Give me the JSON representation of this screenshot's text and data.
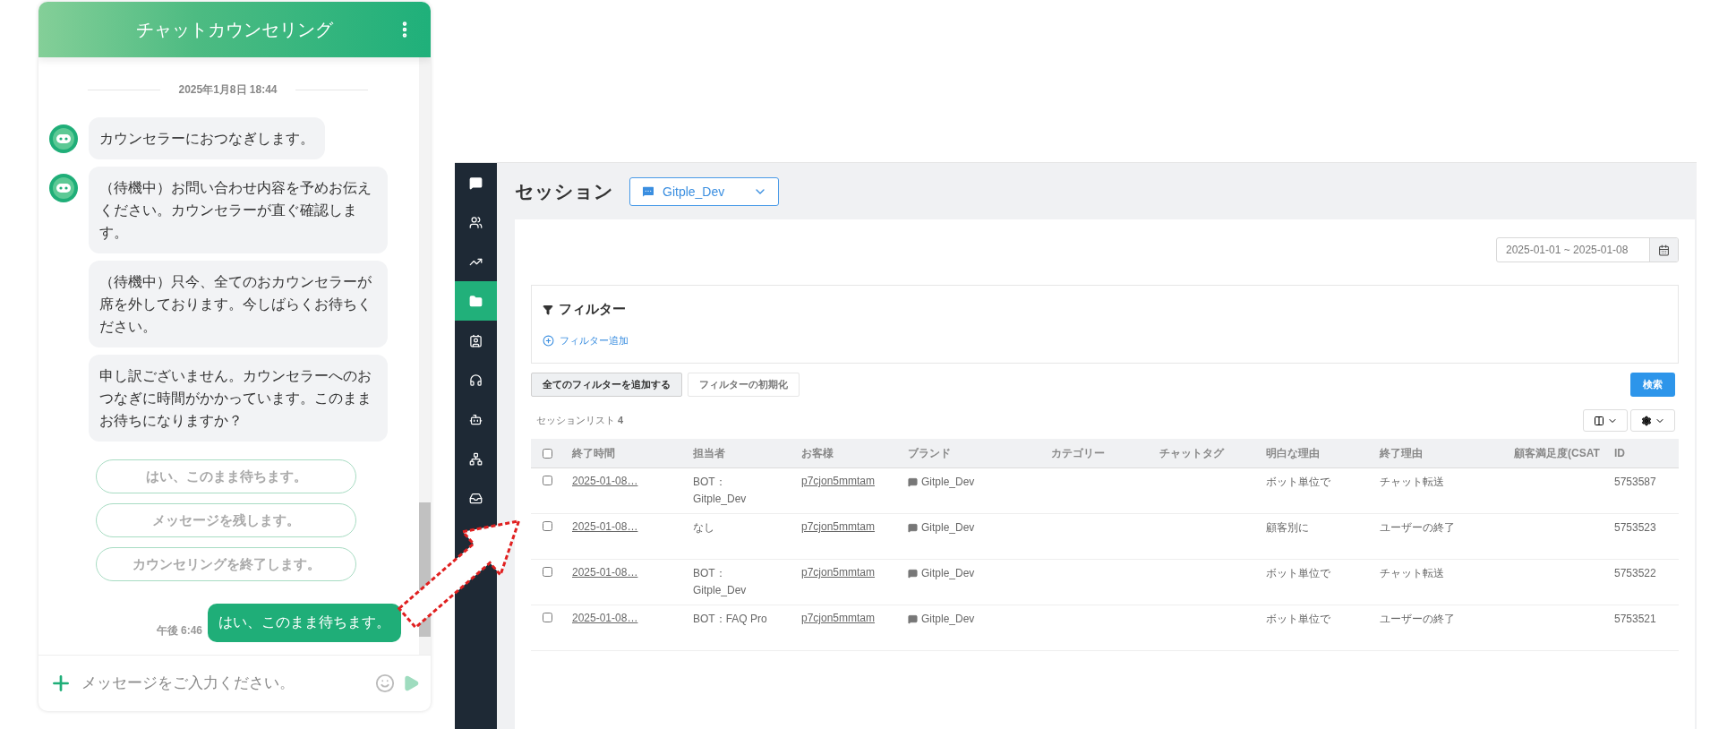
{
  "chat": {
    "title": "チャットカウンセリング",
    "date": "2025年1月8日 18:44",
    "messages": [
      {
        "text": "カウンセラーにおつなぎします。",
        "avatar": true
      },
      {
        "text": "（待機中）お問い合わせ内容を予めお伝えください。カウンセラーが直ぐ確認します。",
        "avatar": true
      },
      {
        "text": "（待機中）只今、全てのおカウンセラーが席を外しております。今しばらくお待ちください。",
        "avatar": false
      },
      {
        "text": "申し訳ございません。カウンセラーへのおつなぎに時間がかかっています。このままお待ちになりますか？",
        "avatar": false
      }
    ],
    "quick_replies": [
      "はい、このまま待ちます。",
      "メッセージを残します。",
      "カウンセリングを終了します。"
    ],
    "user_message": {
      "text": "はい、このまま待ちます。",
      "time": "午後 6:46"
    },
    "input": {
      "placeholder": "メッセージをご入力ください。"
    }
  },
  "admin": {
    "sidebar": {
      "items": [
        {
          "selected": false
        },
        {
          "selected": false
        },
        {
          "selected": false
        },
        {
          "selected": true
        },
        {
          "selected": false
        },
        {
          "selected": false
        },
        {
          "selected": false
        },
        {
          "selected": false
        },
        {
          "selected": false
        }
      ]
    },
    "title": "セッション",
    "brand_select": "Gitple_Dev",
    "date_range": "2025-01-01 ~ 2025-01-08",
    "filter": {
      "title": "フィルター",
      "add_link": "フィルター追加"
    },
    "buttons": {
      "add_all": "全てのフィルターを追加する",
      "reset": "フィルターの初期化",
      "search": "検索"
    },
    "list_label": "セッションリスト",
    "list_count": "4",
    "table": {
      "all_checked": false,
      "columns": [
        "終了時間",
        "担当者",
        "お客様",
        "ブランド",
        "カテゴリー",
        "チャットタグ",
        "明白な理由",
        "終了理由",
        "顧客満足度(CSAT",
        "ID"
      ],
      "rows": [
        {
          "checked": false,
          "end_time": "2025-01-08…",
          "agent": [
            "BOT：",
            "Gitple_Dev"
          ],
          "customer": "p7cjon5mmtam",
          "brand": "Gitple_Dev",
          "reason": "ボット単位で",
          "end_reason": "チャット転送",
          "id": "5753587"
        },
        {
          "checked": false,
          "end_time": "2025-01-08…",
          "agent": [
            "なし"
          ],
          "customer": "p7cjon5mmtam",
          "brand": "Gitple_Dev",
          "reason": "顧客別に",
          "end_reason": "ユーザーの終了",
          "id": "5753523"
        },
        {
          "checked": false,
          "end_time": "2025-01-08…",
          "agent": [
            "BOT：",
            "Gitple_Dev"
          ],
          "customer": "p7cjon5mmtam",
          "brand": "Gitple_Dev",
          "reason": "ボット単位で",
          "end_reason": "チャット転送",
          "id": "5753522"
        },
        {
          "checked": false,
          "end_time": "2025-01-08…",
          "agent": [
            "BOT：FAQ Pro"
          ],
          "customer": "p7cjon5mmtam",
          "brand": "Gitple_Dev",
          "reason": "ボット単位で",
          "end_reason": "ユーザーの終了",
          "id": "5753521"
        }
      ]
    }
  }
}
